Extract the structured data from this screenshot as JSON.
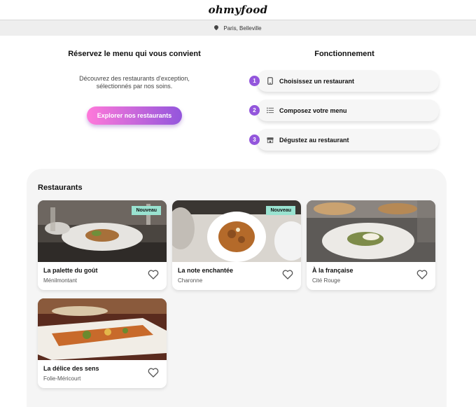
{
  "header": {
    "logo": "ohmyfood"
  },
  "location": {
    "icon": "map-pin-icon",
    "text": "Paris, Belleville"
  },
  "intro": {
    "title": "Réservez le menu qui vous convient",
    "description": "Découvrez des restaurants d'exception, sélectionnés par nos soins.",
    "button_label": "Explorer nos restaurants"
  },
  "how_it_works": {
    "title": "Fonctionnement",
    "steps": [
      {
        "number": "1",
        "icon": "phone-icon",
        "label": "Choisissez un restaurant"
      },
      {
        "number": "2",
        "icon": "list-icon",
        "label": "Composez votre menu"
      },
      {
        "number": "3",
        "icon": "store-icon",
        "label": "Dégustez au restaurant"
      }
    ]
  },
  "restaurants": {
    "title": "Restaurants",
    "items": [
      {
        "name": "La palette du goût",
        "area": "Ménilmontant",
        "badge": "Nouveau"
      },
      {
        "name": "La note enchantée",
        "area": "Charonne",
        "badge": "Nouveau"
      },
      {
        "name": "À la française",
        "area": "Cité Rouge",
        "badge": ""
      },
      {
        "name": "La délice des sens",
        "area": "Folie-Méricourt",
        "badge": ""
      }
    ]
  },
  "colors": {
    "accent_start": "#ff79da",
    "accent_end": "#9356dc",
    "badge": "#99e2d0"
  }
}
